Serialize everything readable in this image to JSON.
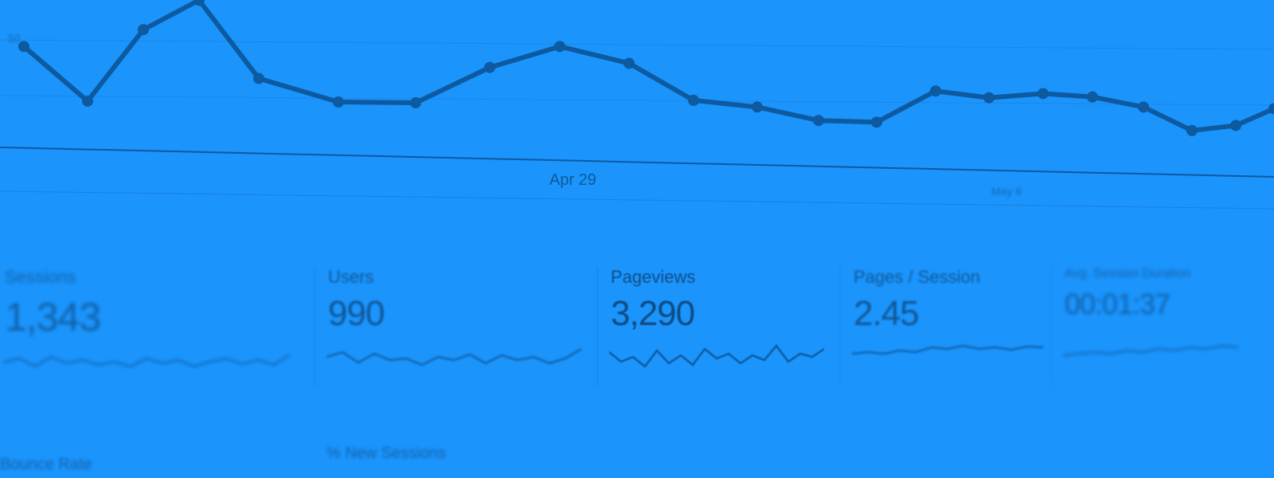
{
  "chart_data": {
    "type": "line",
    "x_labels": [
      "Apr 29",
      "May 6"
    ],
    "y_tick": "50",
    "values": [
      120,
      55,
      140,
      175,
      82,
      54,
      53,
      95,
      120,
      100,
      56,
      48,
      32,
      30,
      67,
      59,
      64,
      60,
      48,
      20,
      26,
      46
    ],
    "grid": true,
    "line_color": "#0d5aa0"
  },
  "metrics": [
    {
      "label": "Sessions",
      "value": "1,343"
    },
    {
      "label": "Users",
      "value": "990"
    },
    {
      "label": "Pageviews",
      "value": "3,290"
    },
    {
      "label": "Pages / Session",
      "value": "2.45"
    },
    {
      "label": "Avg. Session Duration",
      "value": "00:01:37"
    }
  ],
  "bottom_labels": [
    {
      "text": "Bounce Rate"
    },
    {
      "text": "% New Sessions"
    }
  ],
  "colors": {
    "background": "#1b94fc",
    "text": "#0e4b82"
  }
}
